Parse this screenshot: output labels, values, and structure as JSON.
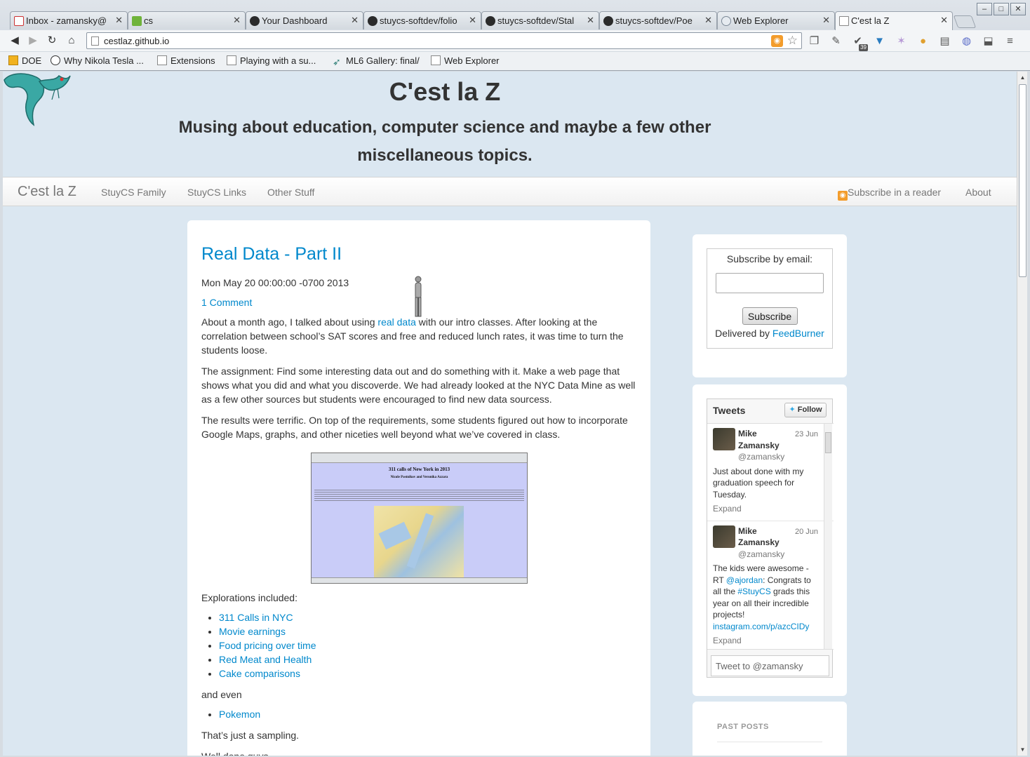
{
  "tabs": [
    {
      "title": "Inbox - zamansky@",
      "icon": "gmail-icon"
    },
    {
      "title": "cs",
      "icon": "cs-icon"
    },
    {
      "title": "Your Dashboard",
      "icon": "github-icon"
    },
    {
      "title": "stuycs-softdev/folio",
      "icon": "github-icon"
    },
    {
      "title": "stuycs-softdev/Stal",
      "icon": "github-icon"
    },
    {
      "title": "stuycs-softdev/Poe",
      "icon": "github-icon"
    },
    {
      "title": "Web Explorer",
      "icon": "cloud-icon"
    },
    {
      "title": "C'est la Z",
      "icon": "page-icon",
      "active": true
    }
  ],
  "address_bar": {
    "url": "cestlaz.github.io"
  },
  "extension_badge": "39",
  "bookmarks": [
    "DOE",
    "Why Nikola Tesla ...",
    "Extensions",
    "Playing with a su...",
    "ML6 Gallery: final/",
    "Web Explorer"
  ],
  "site": {
    "title": "C'est la Z",
    "subtitle": "Musing about education, computer science and maybe a few other miscellaneous topics."
  },
  "navbar": {
    "brand": "C'est la Z",
    "links": [
      "StuyCS Family",
      "StuyCS Links",
      "Other Stuff"
    ],
    "subscribe": "Subscribe in a reader",
    "about": "About"
  },
  "post": {
    "title": "Real Data - Part II",
    "date": "Mon May 20 00:00:00 -0700 2013",
    "comments": "1 Comment",
    "p1_before": "About a month ago, I talked about using ",
    "p1_link": "real data",
    "p1_after": " with our intro classes. After looking at the correlation between school’s SAT scores and free and reduced lunch rates, it was time to turn the students loose.",
    "p2": "The assignment: Find some interesting data out and do something with it. Make a web page that shows what you did and what you discoverde. We had already looked at the NYC Data Mine as well as a few other sources but students were encouraged to find new data sourcess.",
    "p3": "The results were terrific. On top of the requirements, some students figured out how to incorporate Google Maps, graphs, and other niceties well beyond what we’ve covered in class.",
    "screenshot": {
      "title": "311 calls of New York in 2013",
      "authors": "Nicole Postnikov and Veronika Azzara"
    },
    "explorations_intro": "Explorations included:",
    "explorations": [
      "311 Calls in NYC",
      "Movie earnings",
      "Food pricing over time",
      "Red Meat and Health",
      "Cake comparisons"
    ],
    "and_even": "and even",
    "extra": [
      "Pokemon"
    ],
    "sampling": "That’s just a sampling.",
    "closing": "Well done guys."
  },
  "subscribe": {
    "label": "Subscribe by email:",
    "button": "Subscribe",
    "delivered_by": "Delivered by",
    "feedburner": "FeedBurner"
  },
  "tweets": {
    "header": "Tweets",
    "follow": "Follow",
    "items": [
      {
        "name": "Mike Zamansky",
        "handle": "@zamansky",
        "date": "23 Jun",
        "text": "Just about done with my graduation speech for Tuesday.",
        "expand": "Expand"
      },
      {
        "name": "Mike Zamansky",
        "handle": "@zamansky",
        "date": "20 Jun",
        "text_before": "The kids were awesome - RT ",
        "mention": "@ajordan",
        "text_mid": ": Congrats to all the ",
        "hashtag": "#StuyCS",
        "text_after": " grads this year on all their incredible projects!",
        "link": "instagram.com/p/azcCIDy",
        "expand": "Expand"
      }
    ],
    "input_placeholder": "Tweet to @zamansky"
  },
  "past_posts": {
    "title": "PAST POSTS"
  }
}
